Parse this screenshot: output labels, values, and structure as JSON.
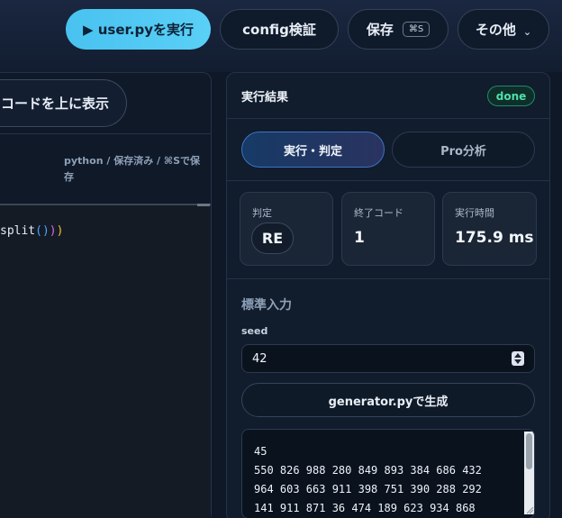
{
  "toolbar": {
    "run_label": "▶ user.pyを実行",
    "config_label": "config検証",
    "save_label": "保存",
    "save_shortcut": "⌘S",
    "more_label": "その他"
  },
  "editor": {
    "show_code_button": "コードを上に表示",
    "meta": "python / 保存済み / ⌘Sで保存",
    "code_fn": "split",
    "code_paren_open1": "(",
    "code_paren_close1": ")",
    "code_paren_close2": ")",
    "code_paren_close3": ")"
  },
  "results": {
    "title": "実行結果",
    "status": "done",
    "tabs": [
      {
        "label": "実行・判定"
      },
      {
        "label": "Pro分析"
      }
    ],
    "stats": [
      {
        "label": "判定",
        "value": "RE"
      },
      {
        "label": "終了コード",
        "value": "1"
      },
      {
        "label": "実行時間",
        "value": "175.9 ms"
      }
    ],
    "stdin_section": {
      "title": "標準入力",
      "seed_label": "seed",
      "seed_value": "42",
      "generate_button": "generator.pyで生成",
      "lines": [
        "45",
        "550 826 988 280 849 893 384 686 432",
        "964 603 663 911 398 751 390 288 292",
        "141 911 871 36 474 189 623 934 868"
      ]
    }
  },
  "colors": {
    "accent": "#49c2f0",
    "done_badge": "#4fe0a8",
    "panel_bg": "#111c2c"
  }
}
